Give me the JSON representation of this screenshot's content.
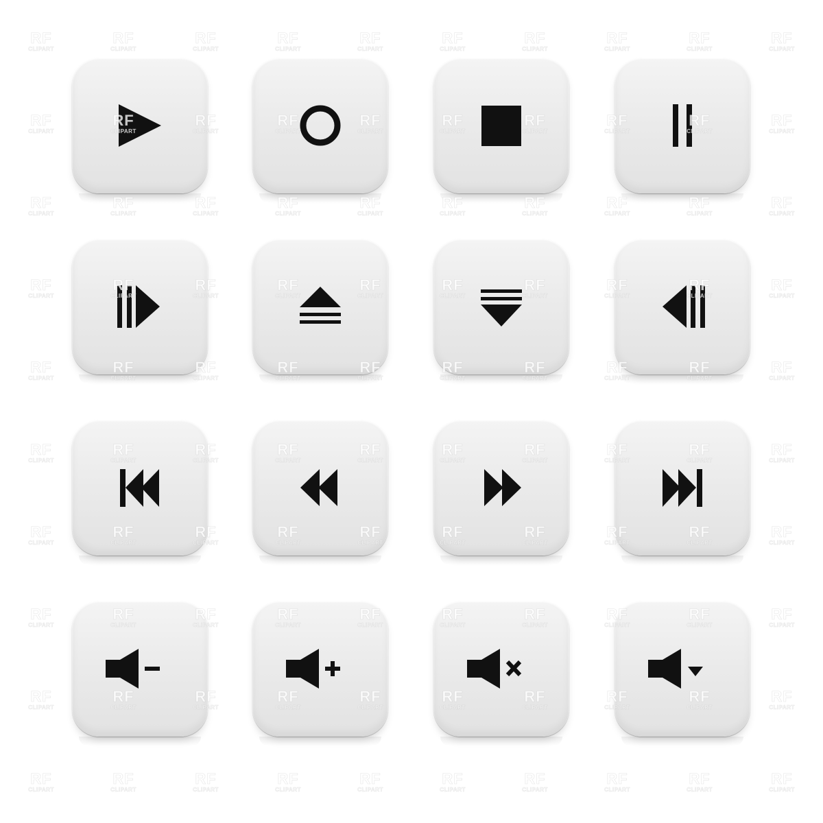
{
  "buttons": [
    {
      "icon": "play-icon"
    },
    {
      "icon": "record-icon"
    },
    {
      "icon": "stop-icon"
    },
    {
      "icon": "pause-icon"
    },
    {
      "icon": "step-forward-icon"
    },
    {
      "icon": "eject-icon"
    },
    {
      "icon": "load-down-icon"
    },
    {
      "icon": "step-backward-icon"
    },
    {
      "icon": "skip-to-start-icon"
    },
    {
      "icon": "rewind-icon"
    },
    {
      "icon": "fast-forward-icon"
    },
    {
      "icon": "skip-to-end-icon"
    },
    {
      "icon": "volume-down-icon"
    },
    {
      "icon": "volume-up-icon"
    },
    {
      "icon": "mute-icon"
    },
    {
      "icon": "volume-menu-icon"
    }
  ],
  "colors": {
    "tile_light": "#f4f4f4",
    "tile_dark": "#e2e2e2",
    "glyph": "#111111",
    "background": "#ffffff"
  },
  "watermark": {
    "line1": "RF",
    "line2": "CLIPART"
  }
}
